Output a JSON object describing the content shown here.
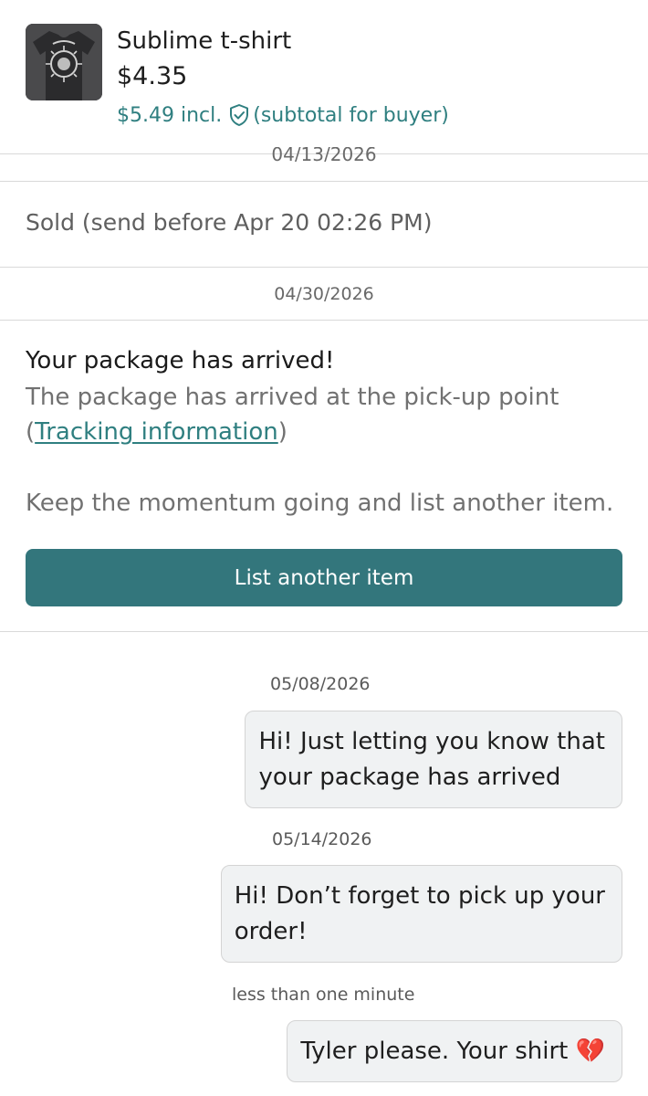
{
  "item": {
    "title": "Sublime t-shirt",
    "price": "$4.35",
    "buyer_total": "$5.49 incl.",
    "buyer_note": "(subtotal for buyer)",
    "thumbnail_icon": "tshirt-photo",
    "shield_icon": "shield-check-icon"
  },
  "timeline": {
    "cut_date": "04/13/2026",
    "sold_status": "Sold (send before Apr 20 02:26 PM)",
    "arrival_date": "04/30/2026"
  },
  "notice": {
    "title": "Your package has arrived!",
    "line1": "The package has arrived at the pick-up point",
    "paren_open": "(",
    "tracking_label": "Tracking information",
    "paren_close": ")",
    "momentum": "Keep the momentum going and list another item."
  },
  "action": {
    "list_button_label": "List another item"
  },
  "messages": [
    {
      "date": "05/08/2026",
      "lines": [
        "Hi! Just letting you know that",
        "your package has arrived"
      ]
    },
    {
      "date": "05/14/2026",
      "lines": [
        "Hi! Don’t forget to pick up your",
        "order!"
      ]
    },
    {
      "date": "less than one minute",
      "lines": [
        "Tyler please. Your shirt 💔"
      ]
    }
  ],
  "colors": {
    "accent": "#2f7f80",
    "button": "#33767c",
    "bubble_bg": "#f0f2f3",
    "divider": "#d9d9d9"
  }
}
